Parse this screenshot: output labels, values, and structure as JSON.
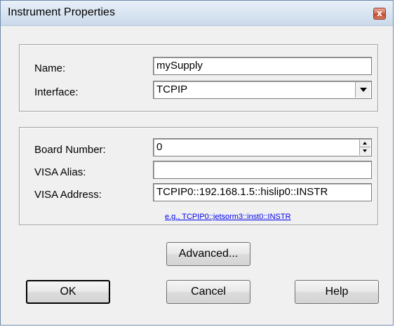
{
  "window": {
    "title": "Instrument Properties",
    "close_glyph": "x"
  },
  "general": {
    "name_label": "Name:",
    "name_value": "mySupply",
    "interface_label": "Interface:",
    "interface_value": "TCPIP"
  },
  "connection": {
    "board_number_label": "Board Number:",
    "board_number_value": "0",
    "visa_alias_label": "VISA Alias:",
    "visa_alias_value": "",
    "visa_address_label": "VISA Address:",
    "visa_address_value": "TCPIP0::192.168.1.5::hislip0::INSTR",
    "example_text": "e.g., TCPIP0::jetsorm3::inst0::INSTR"
  },
  "buttons": {
    "advanced_label": "Advanced...",
    "ok_label": "OK",
    "cancel_label": "Cancel",
    "help_label": "Help"
  },
  "icons": {
    "close": "close-icon",
    "dropdown": "chevron-down-icon",
    "spin_up": "spin-up-icon",
    "spin_down": "spin-down-icon"
  },
  "colors": {
    "link": "#0000ee",
    "close_button": "#c24a30",
    "titlebar": "#d9e5f2"
  }
}
